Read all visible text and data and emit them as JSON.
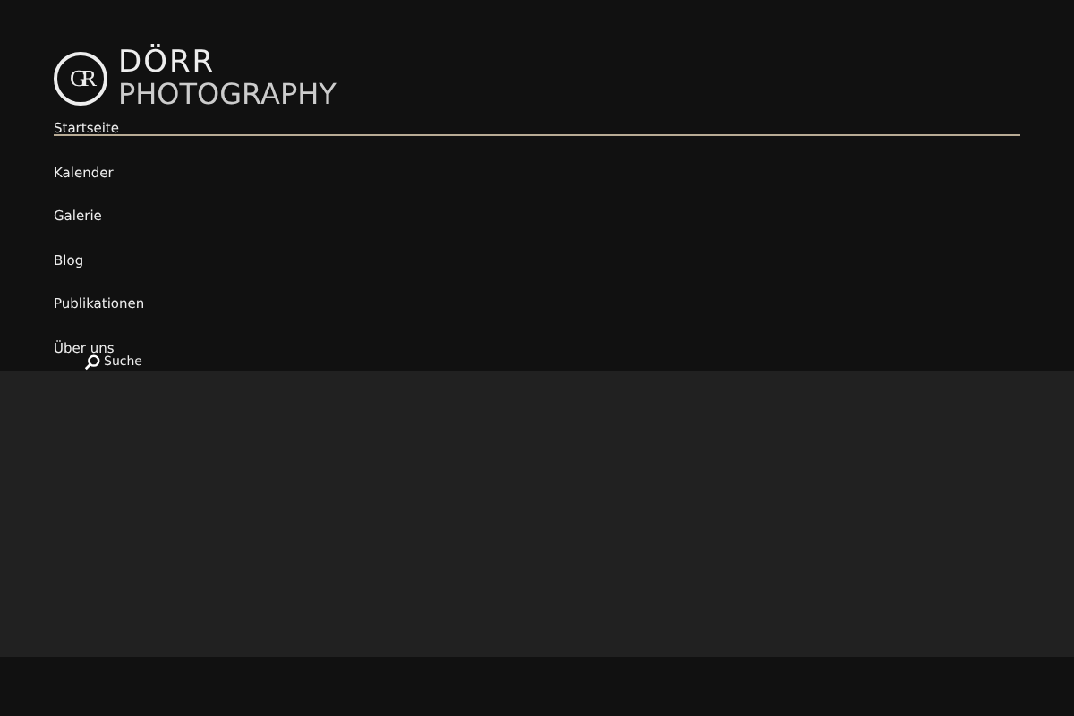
{
  "logo": {
    "monogram": "GR",
    "line_1": "DÖRR",
    "line_2": "PHOTOGRAPHY"
  },
  "nav": [
    {
      "label": "Startseite",
      "selected": true
    },
    {
      "label": "Kalender",
      "selected": false
    },
    {
      "label": "Galerie",
      "selected": false
    },
    {
      "label": "Blog",
      "selected": false
    },
    {
      "label": "Publikationen",
      "selected": false
    },
    {
      "label": "Über uns",
      "selected": false
    }
  ],
  "search": {
    "label": "Suche"
  }
}
